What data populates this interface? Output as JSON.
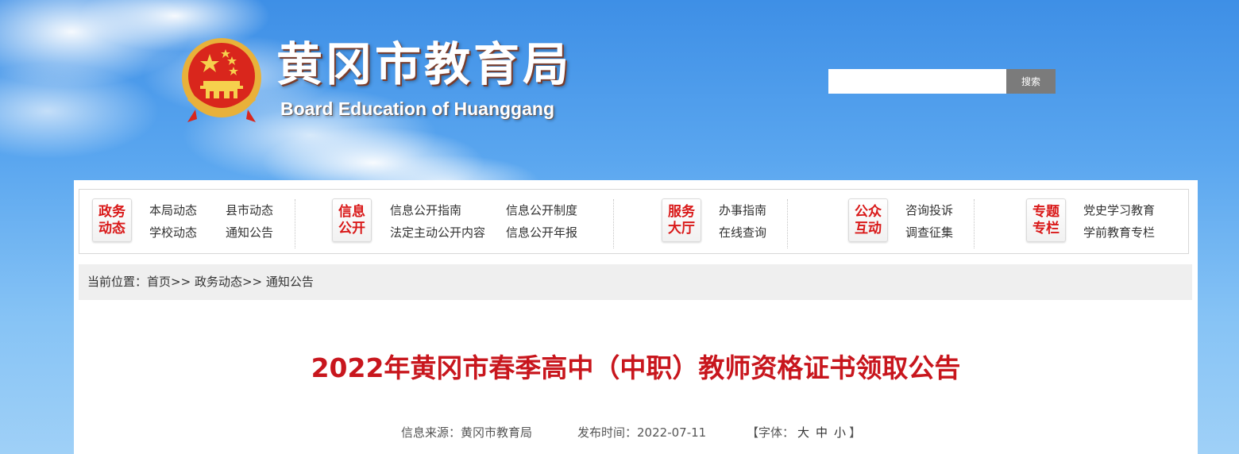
{
  "header": {
    "title": "黄冈市教育局",
    "subtitle": "Board Education of Huanggang",
    "emblem_icon": "national-emblem-icon"
  },
  "search": {
    "placeholder": "",
    "value": "",
    "button_label": "搜索"
  },
  "nav": {
    "groups": [
      {
        "badge_line1": "政务",
        "badge_line2": "动态",
        "links": [
          "本局动态",
          "县市动态",
          "学校动态",
          "通知公告"
        ]
      },
      {
        "badge_line1": "信息",
        "badge_line2": "公开",
        "links": [
          "信息公开指南",
          "信息公开制度",
          "法定主动公开内容",
          "信息公开年报"
        ]
      },
      {
        "badge_line1": "服务",
        "badge_line2": "大厅",
        "links": [
          "办事指南",
          "在线查询"
        ]
      },
      {
        "badge_line1": "公众",
        "badge_line2": "互动",
        "links": [
          "咨询投诉",
          "调查征集"
        ]
      },
      {
        "badge_line1": "专题",
        "badge_line2": "专栏",
        "links": [
          "党史学习教育",
          "学前教育专栏"
        ]
      }
    ]
  },
  "breadcrumb": {
    "prefix": "当前位置：",
    "items": [
      "首页",
      "政务动态",
      "通知公告"
    ],
    "separator": ">>"
  },
  "article": {
    "title": "2022年黄冈市春季高中（中职）教师资格证书领取公告",
    "source_label": "信息来源：",
    "source": "黄冈市教育局",
    "date_label": "发布时间：",
    "date": "2022-07-11",
    "font_label_open": "【字体：",
    "font_large": "大",
    "font_medium": "中",
    "font_small": "小",
    "font_label_close": "】"
  },
  "colors": {
    "accent_red": "#c8161d",
    "badge_red": "#d91818",
    "search_button": "#7b7b7b"
  }
}
